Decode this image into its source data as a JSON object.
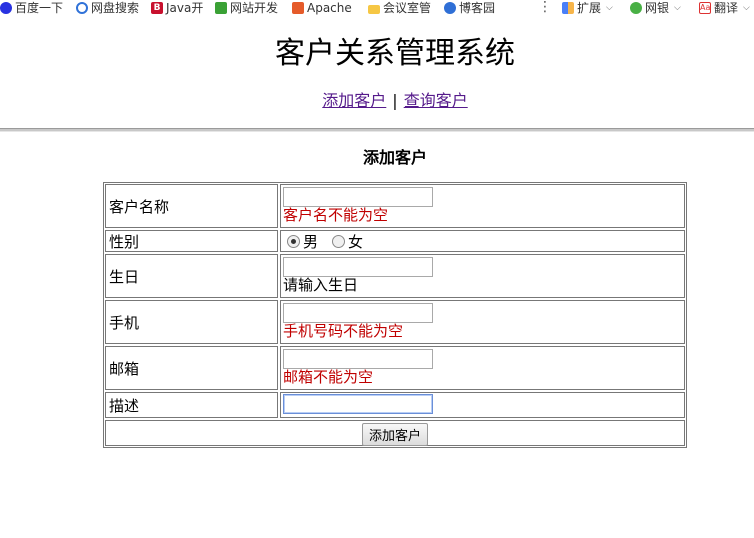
{
  "bookmarks": [
    {
      "label": "百度一下",
      "icon": "baidu-icon"
    },
    {
      "label": "网盘搜索",
      "icon": "netdisk-search-icon"
    },
    {
      "label": "Java开",
      "icon": "b-logo-icon"
    },
    {
      "label": "网站开发",
      "icon": "web-dev-icon"
    },
    {
      "label": "Apache",
      "icon": "apache-icon"
    },
    {
      "label": "会议室管",
      "icon": "folder-icon"
    },
    {
      "label": "博客园",
      "icon": "blog-icon"
    },
    {
      "label": "扩展",
      "icon": "extension-icon"
    },
    {
      "label": "网银",
      "icon": "bank-icon"
    },
    {
      "label": "翻译",
      "icon": "translate-icon"
    }
  ],
  "header": {
    "title": "客户关系管理系统",
    "nav": {
      "add": "添加客户",
      "sep": "|",
      "query": "查询客户"
    }
  },
  "form": {
    "subtitle": "添加客户",
    "name": {
      "label": "客户名称",
      "value": "",
      "error": "客户名不能为空"
    },
    "gender": {
      "label": "性别",
      "male": "男",
      "female": "女",
      "selected": "男"
    },
    "birthday": {
      "label": "生日",
      "value": "",
      "hint": "请输入生日"
    },
    "phone": {
      "label": "手机",
      "value": "",
      "error": "手机号码不能为空"
    },
    "email": {
      "label": "邮箱",
      "value": "",
      "error": "邮箱不能为空"
    },
    "description": {
      "label": "描述",
      "value": ""
    },
    "submit": "添加客户"
  }
}
